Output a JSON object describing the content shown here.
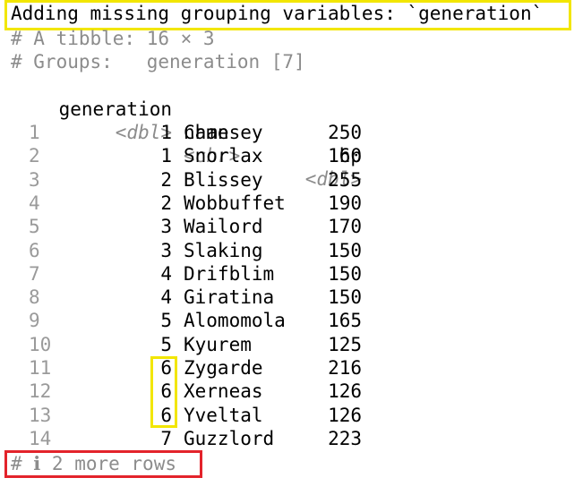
{
  "console": {
    "warning": "Adding missing grouping variables: `generation`",
    "tibble_info": "# A tibble: 16 × 3",
    "groups_info": "# Groups:   generation [7]",
    "columns": [
      {
        "name": "generation",
        "type": "<dbl>"
      },
      {
        "name": "name",
        "type": "<chr>"
      },
      {
        "name": "hp",
        "type": "<dbl>"
      }
    ],
    "rows": [
      {
        "index": "1",
        "generation": "1",
        "name": "Chansey",
        "hp": "250"
      },
      {
        "index": "2",
        "generation": "1",
        "name": "Snorlax",
        "hp": "160"
      },
      {
        "index": "3",
        "generation": "2",
        "name": "Blissey",
        "hp": "255"
      },
      {
        "index": "4",
        "generation": "2",
        "name": "Wobbuffet",
        "hp": "190"
      },
      {
        "index": "5",
        "generation": "3",
        "name": "Wailord",
        "hp": "170"
      },
      {
        "index": "6",
        "generation": "3",
        "name": "Slaking",
        "hp": "150"
      },
      {
        "index": "7",
        "generation": "4",
        "name": "Drifblim",
        "hp": "150"
      },
      {
        "index": "8",
        "generation": "4",
        "name": "Giratina",
        "hp": "150"
      },
      {
        "index": "9",
        "generation": "5",
        "name": "Alomomola",
        "hp": "165"
      },
      {
        "index": "10",
        "generation": "5",
        "name": "Kyurem",
        "hp": "125"
      },
      {
        "index": "11",
        "generation": "6",
        "name": "Zygarde",
        "hp": "216"
      },
      {
        "index": "12",
        "generation": "6",
        "name": "Xerneas",
        "hp": "126"
      },
      {
        "index": "13",
        "generation": "6",
        "name": "Yveltal",
        "hp": "126"
      },
      {
        "index": "14",
        "generation": "7",
        "name": "Guzzlord",
        "hp": "223"
      }
    ],
    "more_rows": "# ℹ 2 more rows"
  },
  "colors": {
    "highlight_yellow": "#f2e600",
    "highlight_red": "#e3232b",
    "comment_gray": "#8c8c8c"
  }
}
